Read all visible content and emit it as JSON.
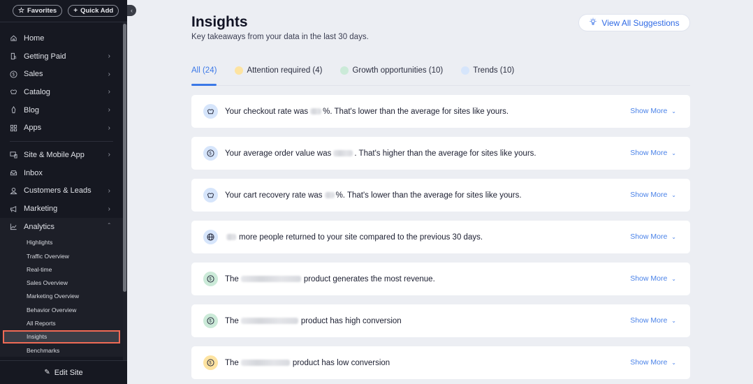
{
  "sidebar": {
    "favorites_label": "Favorites",
    "quick_add_label": "Quick Add",
    "nav_items": [
      {
        "label": "Home",
        "icon": "home-icon",
        "has_chevron": false
      },
      {
        "label": "Getting Paid",
        "icon": "invoice-icon",
        "has_chevron": true
      },
      {
        "label": "Sales",
        "icon": "dollar-circle-icon",
        "has_chevron": true
      },
      {
        "label": "Catalog",
        "icon": "catalog-icon",
        "has_chevron": true
      },
      {
        "label": "Blog",
        "icon": "pen-nib-icon",
        "has_chevron": true
      },
      {
        "label": "Apps",
        "icon": "apps-icon",
        "has_chevron": true
      }
    ],
    "nav_items_2": [
      {
        "label": "Site & Mobile App",
        "icon": "devices-icon",
        "has_chevron": true
      },
      {
        "label": "Inbox",
        "icon": "inbox-icon",
        "has_chevron": false
      },
      {
        "label": "Customers & Leads",
        "icon": "customers-icon",
        "has_chevron": true
      },
      {
        "label": "Marketing",
        "icon": "megaphone-icon",
        "has_chevron": true
      }
    ],
    "analytics": {
      "label": "Analytics",
      "icon": "chart-line-icon",
      "expanded": true,
      "sub_items": [
        {
          "label": "Highlights",
          "selected": false
        },
        {
          "label": "Traffic Overview",
          "selected": false
        },
        {
          "label": "Real-time",
          "selected": false
        },
        {
          "label": "Sales Overview",
          "selected": false
        },
        {
          "label": "Marketing Overview",
          "selected": false
        },
        {
          "label": "Behavior Overview",
          "selected": false
        },
        {
          "label": "All Reports",
          "selected": false
        },
        {
          "label": "Insights",
          "selected": true
        },
        {
          "label": "Benchmarks",
          "selected": false
        }
      ]
    },
    "edit_site_label": "Edit Site"
  },
  "header": {
    "title": "Insights",
    "subtitle": "Key takeaways from your data in the last 30 days.",
    "view_all_label": "View All Suggestions"
  },
  "tabs": [
    {
      "label": "All (24)",
      "active": true,
      "dot_color": null
    },
    {
      "label": "Attention required (4)",
      "active": false,
      "dot_color": "#fde3a1"
    },
    {
      "label": "Growth opportunities (10)",
      "active": false,
      "dot_color": "#cbead8"
    },
    {
      "label": "Trends (10)",
      "active": false,
      "dot_color": "#d6e5fb"
    }
  ],
  "colors": {
    "accent": "#3b78e7",
    "attention": "#fde3a1",
    "growth": "#cbead8",
    "trend": "#d6e5fb",
    "selection_outline": "#ef6a55"
  },
  "insights": [
    {
      "icon": "cart-icon",
      "icon_bg": "#d6e5fb",
      "before": "Your checkout rate was",
      "after": "%. That's lower than the average for sites like yours.",
      "redacted_width": 16,
      "show_more": "Show More"
    },
    {
      "icon": "dollar-circle-icon",
      "icon_bg": "#d6e5fb",
      "before": "Your average order value was",
      "after": ". That's higher than the average for sites like yours.",
      "redacted_width": 28,
      "show_more": "Show More"
    },
    {
      "icon": "cart-icon",
      "icon_bg": "#d6e5fb",
      "before": "Your cart recovery rate was",
      "after": "%. That's lower than the average for sites like yours.",
      "redacted_width": 14,
      "show_more": "Show More"
    },
    {
      "icon": "globe-icon",
      "icon_bg": "#d6e5fb",
      "before": "",
      "after": "more people returned to your site compared to the previous 30 days.",
      "redacted_width": 14,
      "show_more": "Show More"
    },
    {
      "icon": "dollar-circle-icon",
      "icon_bg": "#cbead8",
      "before": "The",
      "after": "product generates the most revenue.",
      "redacted_width": 86,
      "show_more": "Show More"
    },
    {
      "icon": "dollar-circle-icon",
      "icon_bg": "#cbead8",
      "before": "The",
      "after": "product has high conversion",
      "redacted_width": 82,
      "show_more": "Show More"
    },
    {
      "icon": "dollar-circle-icon",
      "icon_bg": "#fde3a1",
      "before": "The",
      "after": "product has low conversion",
      "redacted_width": 70,
      "show_more": "Show More"
    }
  ]
}
